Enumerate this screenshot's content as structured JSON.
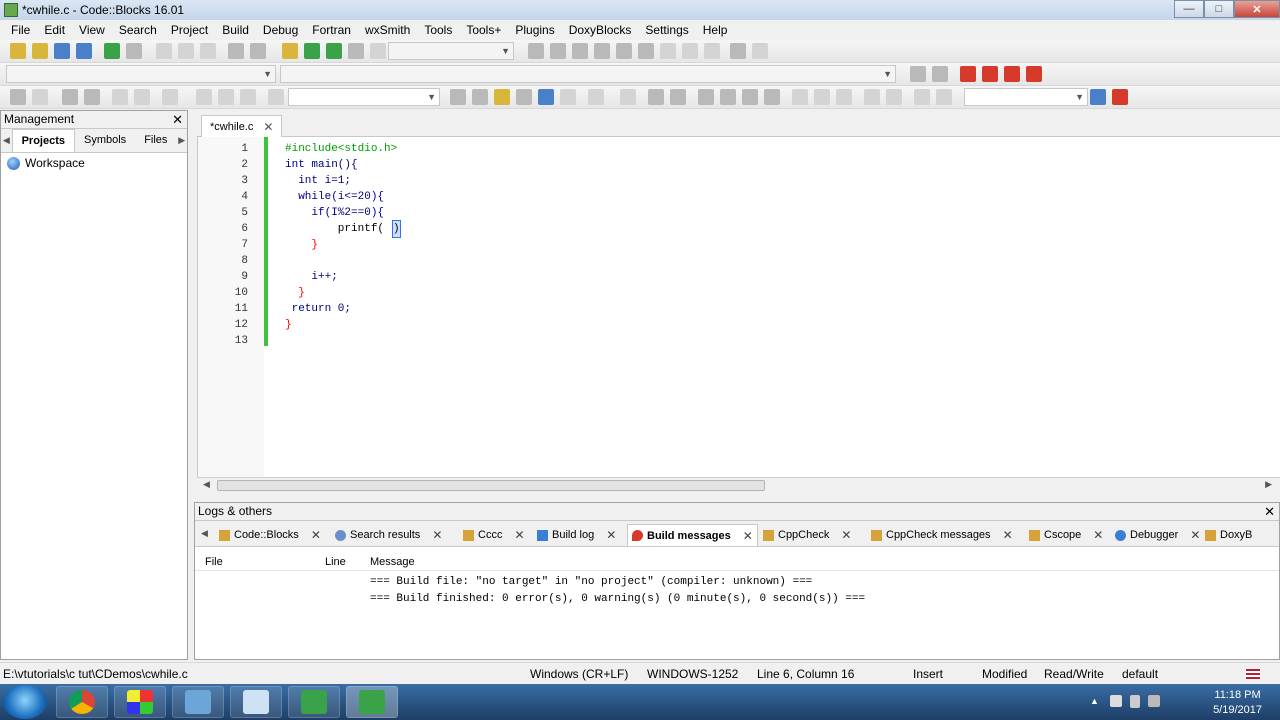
{
  "window": {
    "title": "*cwhile.c - Code::Blocks 16.01",
    "buttons": [
      "minimize-button",
      "maximize-button",
      "close-button"
    ]
  },
  "menu": [
    "File",
    "Edit",
    "View",
    "Search",
    "Project",
    "Build",
    "Debug",
    "Fortran",
    "wxSmith",
    "Tools",
    "Tools+",
    "Plugins",
    "DoxyBlocks",
    "Settings",
    "Help"
  ],
  "management": {
    "title": "Management",
    "tabs": [
      "Projects",
      "Symbols",
      "Files"
    ],
    "active_tab": "Projects",
    "tree_root": "Workspace"
  },
  "editor": {
    "tab_label": "*cwhile.c",
    "lines": [
      {
        "n": "1",
        "text": "#include<stdio.h>"
      },
      {
        "n": "2",
        "text": "int main(){"
      },
      {
        "n": "3",
        "text": "  int i=1;"
      },
      {
        "n": "4",
        "text": "  while(i<=20){"
      },
      {
        "n": "5",
        "text": "    if(I%2==0){"
      },
      {
        "n": "6",
        "text": "        printf("
      },
      {
        "n": "7",
        "text": "    }"
      },
      {
        "n": "8",
        "text": ""
      },
      {
        "n": "9",
        "text": "    i++;"
      },
      {
        "n": "10",
        "text": "  }"
      },
      {
        "n": "11",
        "text": " return 0;"
      },
      {
        "n": "12",
        "text": "}"
      },
      {
        "n": "13",
        "text": ""
      }
    ],
    "line6_cursor_char": ")"
  },
  "logs": {
    "title": "Logs & others",
    "tabs": [
      "Code::Blocks",
      "Search results",
      "Cccc",
      "Build log",
      "Build messages",
      "CppCheck",
      "CppCheck messages",
      "Cscope",
      "Debugger",
      "DoxyB"
    ],
    "active_tab": "Build messages",
    "columns": [
      "File",
      "Line",
      "Message"
    ],
    "messages": [
      "=== Build file: \"no target\" in \"no project\" (compiler: unknown) ===",
      "=== Build finished: 0 error(s), 0 warning(s) (0 minute(s), 0 second(s)) ==="
    ]
  },
  "status": {
    "path": "E:\\vtutorials\\c tut\\CDemos\\cwhile.c",
    "eol": "Windows (CR+LF)",
    "encoding": "WINDOWS-1252",
    "position": "Line 6, Column 16",
    "mode": "Insert",
    "modified": "Modified",
    "access": "Read/Write",
    "profile": "default"
  },
  "taskbar": {
    "time": "11:18 PM",
    "date": "5/19/2017"
  },
  "colors": {
    "keyword": "#000080",
    "preprocessor": "#00a000",
    "number": "#f000f0",
    "operator": "#ff0000",
    "change_bar": "#3cc43c"
  }
}
